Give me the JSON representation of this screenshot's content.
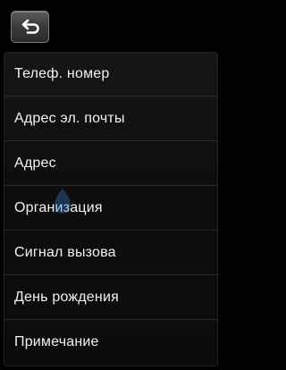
{
  "header": {
    "back_icon": "back-arrow-icon"
  },
  "menu": {
    "items": [
      {
        "label": "Телеф. номер"
      },
      {
        "label": "Адрес эл. почты"
      },
      {
        "label": "Адрес"
      },
      {
        "label": "Организация"
      },
      {
        "label": "Сигнал вызова"
      },
      {
        "label": "День рождения"
      },
      {
        "label": "Примечание"
      }
    ]
  },
  "colors": {
    "background": "#000000",
    "text": "#f2f2f2",
    "divider": "#2b2b2b",
    "button": "#3a3a3a"
  }
}
